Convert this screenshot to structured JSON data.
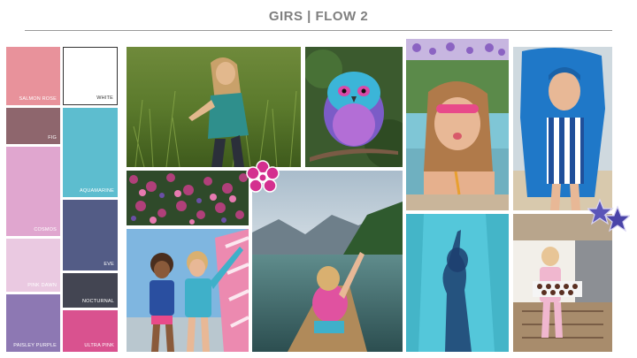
{
  "page": {
    "title": "GIRS | FLOW 2"
  },
  "palette": {
    "salmon_rose": {
      "label": "SALMON ROSE",
      "color": "#e8929b"
    },
    "white": {
      "label": "WHITE",
      "color": "#ffffff"
    },
    "fig": {
      "label": "FIG",
      "color": "#8e666d"
    },
    "aquamarine": {
      "label": "AQUAMARINE",
      "color": "#5dbdcf"
    },
    "cosmos": {
      "label": "COSMOS",
      "color": "#e0a6cf"
    },
    "eve": {
      "label": "EVE",
      "color": "#535c86"
    },
    "pink_dawn": {
      "label": "PINK DAWN",
      "color": "#eac9e1"
    },
    "nocturnal": {
      "label": "NOCTURNAL",
      "color": "#434552"
    },
    "paisley_purple": {
      "label": "PAISLEY PURPLE",
      "color": "#8d78b3"
    },
    "ultra_pink": {
      "label": "ULTRA PINK",
      "color": "#d9528f"
    }
  }
}
